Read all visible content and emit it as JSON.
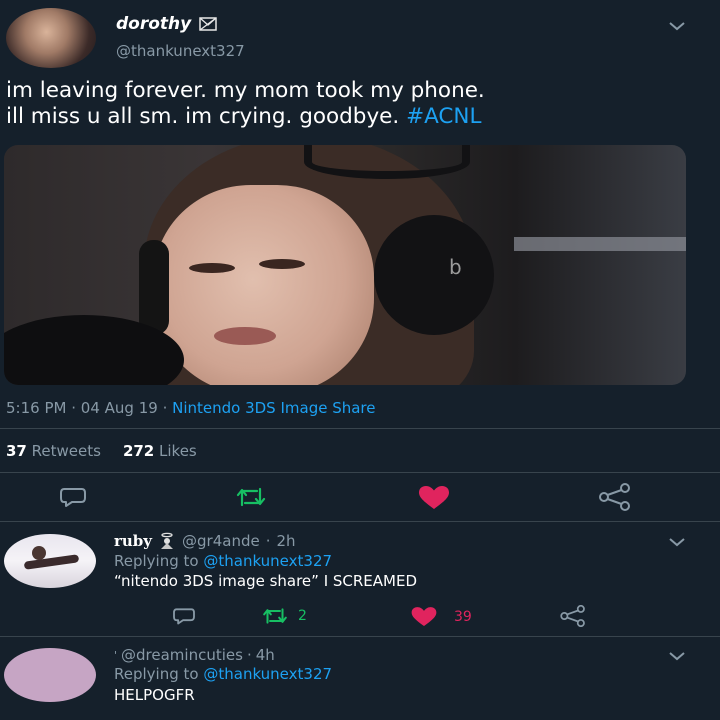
{
  "tweet": {
    "display_name": "dorothy",
    "handle": "@thankunext327",
    "text_line1": "im leaving forever. my mom took my phone.",
    "text_line2_plain": "ill miss u all sm. im crying. goodbye.",
    "hashtag": "#ACNL",
    "time": "5:16 PM",
    "date": "04 Aug 19",
    "source": "Nintendo 3DS Image Share",
    "retweets_count": "37",
    "retweets_label": "Retweets",
    "likes_count": "272",
    "likes_label": "Likes"
  },
  "replies": [
    {
      "display_name": "ruby",
      "handle": "@gr4ande",
      "age": "2h",
      "replying_prefix": "Replying to",
      "replying_to": "@thankunext327",
      "text": "“nitendo 3DS image share” I SCREAMED",
      "retweets": "2",
      "likes": "39"
    },
    {
      "display_name": "'",
      "handle": "@dreamincuties",
      "age": "4h",
      "replying_prefix": "Replying to",
      "replying_to": "@thankunext327",
      "text": "HELPOGFR"
    }
  ],
  "colors": {
    "background": "#15202b",
    "accent": "#1da1f2",
    "retweet": "#17bf63",
    "like": "#e0245e",
    "muted": "#8899a6"
  },
  "icons": [
    "chevron-down-icon",
    "reply-icon",
    "retweet-icon",
    "heart-icon",
    "share-icon"
  ]
}
